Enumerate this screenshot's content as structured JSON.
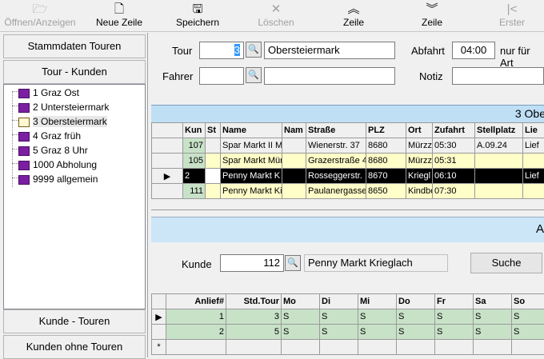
{
  "toolbar": {
    "open": {
      "label": "Öffnen/Anzeigen",
      "icon": "folder-open-icon"
    },
    "new_row": {
      "label": "Neue Zeile",
      "icon": "new-document-icon"
    },
    "save": {
      "label": "Speichern",
      "icon": "floppy-disk-icon"
    },
    "delete": {
      "label": "Löschen",
      "icon": "x-icon"
    },
    "row_up": {
      "label": "Zeile",
      "icon": "double-chevron-up-icon"
    },
    "row_down": {
      "label": "Zeile",
      "icon": "double-chevron-down-icon"
    },
    "first": {
      "label": "Erster",
      "icon": "first-record-icon"
    }
  },
  "left": {
    "btn_master": "Stammdaten Touren",
    "btn_tour_customers": "Tour - Kunden",
    "tree": [
      {
        "label": "1 Graz Ost",
        "open": false
      },
      {
        "label": "2 Untersteiermark",
        "open": false
      },
      {
        "label": "3 Obersteiermark",
        "open": true,
        "selected": true
      },
      {
        "label": "4 Graz früh",
        "open": false
      },
      {
        "label": "5 Graz 8 Uhr",
        "open": false
      },
      {
        "label": "1000 Abholung",
        "open": false
      },
      {
        "label": "9999 allgemein",
        "open": false
      }
    ],
    "btn_customer_tours": "Kunde - Touren",
    "btn_customers_no_tours": "Kunden ohne Touren"
  },
  "form": {
    "tour_label": "Tour",
    "tour_value": "3",
    "tour_name": "Obersteiermark",
    "departure_label": "Abfahrt",
    "departure_value": "04:00",
    "departure_suffix": "nur für Art",
    "driver_label": "Fahrer",
    "driver_value": "",
    "driver_name": "",
    "note_label": "Notiz",
    "note_value": ""
  },
  "tour_grid": {
    "title": "3 Obe",
    "columns": [
      "Kun",
      "St",
      "Name",
      "Nam",
      "Straße",
      "PLZ",
      "Ort",
      "Zufahrt",
      "Stellplatz",
      "Lie"
    ],
    "rows": [
      {
        "kun": "107",
        "st": "",
        "name": "Spar Markt II M",
        "nam": "",
        "str": "Wienerstr. 37",
        "plz": "8680",
        "ort": "Mürzze",
        "zuf": "05:30",
        "stp": "A.09.24",
        "lie": "Lief"
      },
      {
        "kun": "105",
        "st": "",
        "name": "Spar Markt Mür",
        "nam": "",
        "str": "Grazerstraße 4",
        "plz": "8680",
        "ort": "Mürzze",
        "zuf": "05:31",
        "stp": "",
        "lie": ""
      },
      {
        "kun": "2",
        "st": "",
        "name": "Penny Markt K",
        "nam": "",
        "str": "Rosseggerstr.",
        "plz": "8670",
        "ort": "Kriegl",
        "zuf": "06:10",
        "stp": "",
        "lie": "Lief"
      },
      {
        "kun": "111",
        "st": "",
        "name": "Penny Markt Ki",
        "nam": "",
        "str": "Paulanergasse",
        "plz": "8650",
        "ort": "Kindbe",
        "zuf": "07:30",
        "stp": "",
        "lie": ""
      }
    ]
  },
  "bottom": {
    "title": "A",
    "customer_label": "Kunde",
    "customer_value": "112",
    "customer_name": "Penny Markt Krieglach",
    "search_button": "Suche",
    "columns": [
      "Anlief#",
      "Std.Tour",
      "Mo",
      "Di",
      "Mi",
      "Do",
      "Fr",
      "Sa",
      "So"
    ],
    "rows": [
      {
        "n": "1",
        "tour": "3",
        "mo": "S",
        "di": "S",
        "mi": "S",
        "do": "S",
        "fr": "S",
        "sa": "S",
        "so": "S"
      },
      {
        "n": "2",
        "tour": "5",
        "mo": "S",
        "di": "S",
        "mi": "S",
        "do": "S",
        "fr": "S",
        "sa": "S",
        "so": "S"
      }
    ],
    "new_row_marker": "*"
  },
  "colors": {
    "accent_band": "#bfdff5",
    "selected_row": "#000000",
    "row_yellow": "#fffdc8",
    "row_green": "#c8e2c8"
  }
}
